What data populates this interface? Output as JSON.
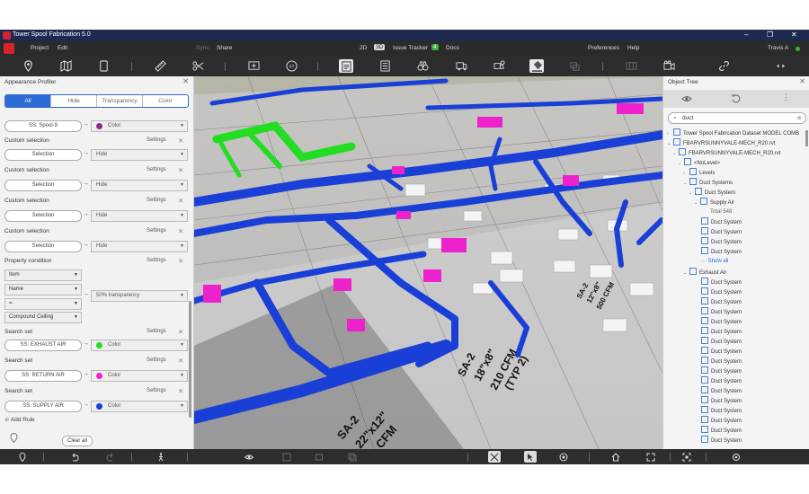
{
  "app": {
    "title": "Tower Spool Fabrication 5.0"
  },
  "menu": {
    "project": "Project",
    "edit": "Edit",
    "sync": "Sync",
    "share": "Share",
    "mode_2d": "2D",
    "mode_3d": "3D",
    "issue_tracker": "Issue Tracker",
    "issue_count": "4",
    "docs": "Docs",
    "preferences": "Preferences",
    "help": "Help",
    "user": "Travis A"
  },
  "toolbar": {
    "icons": [
      "map-pin-icon",
      "map-icon",
      "tablet-icon",
      "ruler-icon",
      "scissors-icon",
      "add-view-icon",
      "st-icon",
      "clipboard-icon",
      "list-icon",
      "binoculars-icon",
      "truck-icon",
      "truck-list-icon",
      "paint-bucket-icon",
      "layers-icon",
      "film-icon",
      "video-icon",
      "link-icon",
      "expand-icon"
    ],
    "st_label": "ST"
  },
  "appearance_profiler": {
    "title": "Appearance Profiler",
    "tabs": [
      "All",
      "Hide",
      "Transparency",
      "Color"
    ],
    "first_rule": {
      "pill": "SS: Spool-9",
      "action": "Color",
      "color": "#8b2a8b"
    },
    "custom_rules": [
      {
        "label": "Custom selection",
        "settings": "Settings",
        "pill": "Selection",
        "action": "Hide"
      },
      {
        "label": "Custom selection",
        "settings": "Settings",
        "pill": "Selection",
        "action": "Hide"
      },
      {
        "label": "Custom selection",
        "settings": "Settings",
        "pill": "Selection",
        "action": "Hide"
      },
      {
        "label": "Custom selection",
        "settings": "Settings",
        "pill": "Selection",
        "action": "Hide"
      }
    ],
    "property_condition": {
      "label": "Property condition",
      "settings": "Settings",
      "field1": "Item",
      "field2": "Name",
      "field3": "=",
      "field4": "Compound Ceiling",
      "action": "50% transparency"
    },
    "search_sets": [
      {
        "label": "Search set",
        "settings": "Settings",
        "pill": "SS: EXHAUST AIR",
        "action": "Color",
        "color": "#22cc22"
      },
      {
        "label": "Search set",
        "settings": "Settings",
        "pill": "SS: RETURN AIR",
        "action": "Color",
        "color": "#ee22cc"
      },
      {
        "label": "Search set",
        "settings": "Settings",
        "pill": "SS: SUPPLY AIR",
        "action": "Color",
        "color": "#1a3fd6"
      }
    ],
    "add_rule": "Add Rule",
    "clear_all": "Clear all"
  },
  "object_tree": {
    "title": "Object Tree",
    "search_value": "duct",
    "nodes": [
      "Tower Spool Fabrication Dataset MODEL COMB",
      "FBARVRSUNNYVALE-MECH_R20.rvt",
      "FBARVRSUNNYVALE-MECH_R20.rvt",
      "<NoLevel>",
      "Levels",
      "Duct Systems",
      "Duct System",
      "Supply Air",
      "Total 548",
      "Show all",
      "Exhaust Air"
    ],
    "item": "Duct System"
  },
  "viewport_labels": {
    "lbl1": "SA-2",
    "lbl2": "18\"x8\"",
    "lbl3": "210 CFM",
    "lbl4": "(TYP 2)",
    "lbl5": "SA-2",
    "lbl6": "22\"x12\"",
    "lbl7": "CFM",
    "lbl8": "SA-2",
    "lbl9": "12\"x8\"",
    "lbl10": "500 CFM"
  },
  "colors": {
    "supply": "#1a3fd6",
    "exhaust": "#22dd22",
    "return": "#ee22cc",
    "titlebar": "#1c2a52",
    "accent": "#2d6bd6"
  }
}
